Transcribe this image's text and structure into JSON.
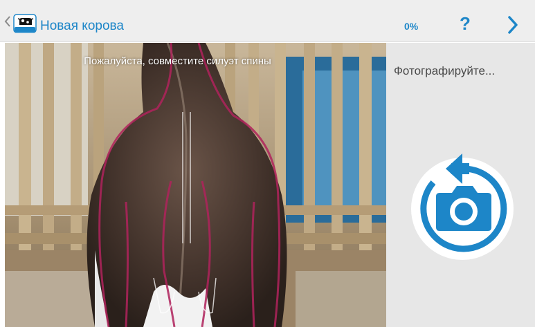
{
  "header": {
    "title": "Новая корова",
    "progress": "0%",
    "help_label": "?"
  },
  "camera": {
    "hint": "Пожалуйста, совместите силуэт спины"
  },
  "side_panel": {
    "status": "Фотографируйте..."
  },
  "colors": {
    "accent": "#1d86c8",
    "overlay_outline": "#b0235c",
    "header_bg": "#eeeeee",
    "panel_bg": "#e7e7e7"
  },
  "icons": {
    "back": "chevron-left-icon",
    "logo": "cow-logo-icon",
    "help": "question-icon",
    "next": "chevron-right-icon",
    "shutter": "camera-rotate-icon"
  }
}
